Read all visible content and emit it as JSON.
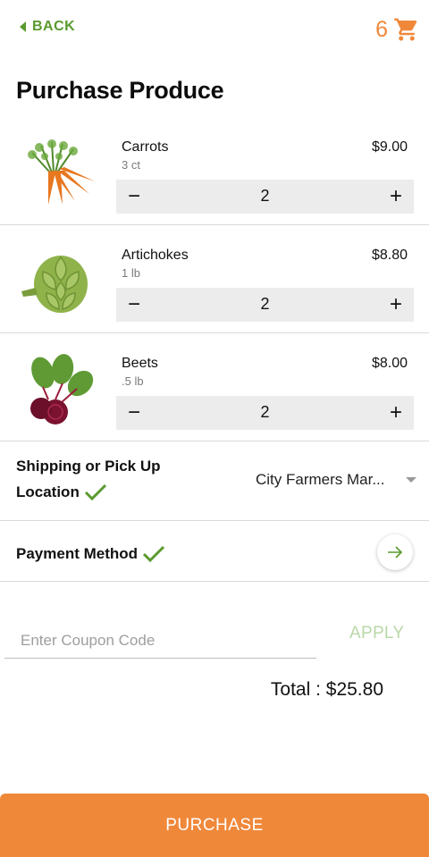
{
  "header": {
    "back_label": "BACK",
    "cart_count": "6",
    "cart_icon": "shopping-cart-icon"
  },
  "page_title": "Purchase Produce",
  "items": [
    {
      "name": "Carrots",
      "unit": "3 ct",
      "price": "$9.00",
      "quantity": "2",
      "image": "carrots-image"
    },
    {
      "name": "Artichokes",
      "unit": "1 lb",
      "price": "$8.80",
      "quantity": "2",
      "image": "artichoke-image"
    },
    {
      "name": "Beets",
      "unit": ".5 lb",
      "price": "$8.00",
      "quantity": "2",
      "image": "beets-image"
    }
  ],
  "stepper": {
    "minus": "−",
    "plus": "+"
  },
  "shipping": {
    "label_line1": "Shipping or Pick Up",
    "label_line2": "Location",
    "selected": "City Farmers Mar..."
  },
  "payment": {
    "label": "Payment Method"
  },
  "coupon": {
    "placeholder": "Enter Coupon Code",
    "apply_label": "APPLY"
  },
  "total": "Total : $25.80",
  "purchase_label": "PURCHASE",
  "colors": {
    "accent": "#f0883a",
    "green": "#5a9a2e",
    "apply_green": "#b9d8a7"
  }
}
